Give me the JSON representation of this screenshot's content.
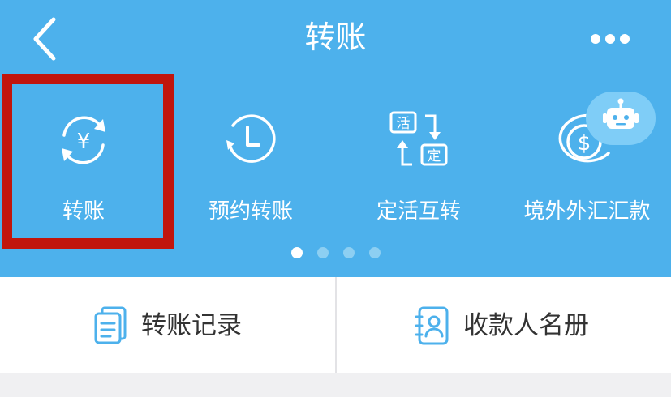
{
  "header": {
    "title": "转账",
    "back_icon": "chevron-left-icon",
    "more_icon": "more-dots-icon",
    "background_color": "#4db1ec"
  },
  "quick_actions": [
    {
      "label": "转账",
      "icon": "yuan-cycle-icon",
      "highlighted": true
    },
    {
      "label": "预约转账",
      "icon": "clock-icon",
      "highlighted": false
    },
    {
      "label": "定活互转",
      "icon": "fixed-current-swap-icon",
      "highlighted": false
    },
    {
      "label": "境外外汇汇款",
      "icon": "dollar-coin-icon",
      "highlighted": false
    }
  ],
  "assistant": {
    "icon": "robot-icon"
  },
  "pagination": {
    "total": 4,
    "current": 1
  },
  "bottom_actions": [
    {
      "label": "转账记录",
      "icon": "document-list-icon"
    },
    {
      "label": "收款人名册",
      "icon": "contact-book-icon"
    }
  ],
  "colors": {
    "highlight_border": "#c1150d",
    "accent_icon": "#4db1ec",
    "text_dark": "#333333"
  }
}
